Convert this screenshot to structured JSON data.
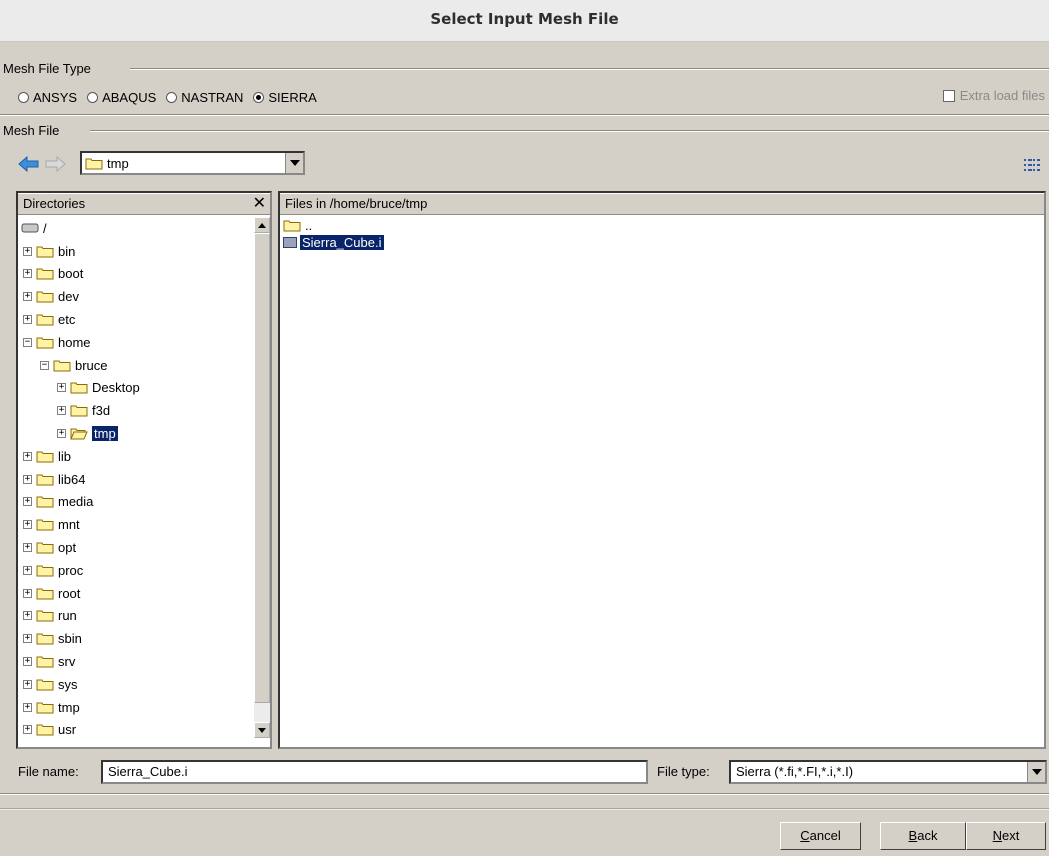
{
  "window": {
    "title": "Select Input Mesh File"
  },
  "mesh_file_type": {
    "label": "Mesh File Type",
    "options": [
      {
        "label": "ANSYS",
        "selected": false
      },
      {
        "label": "ABAQUS",
        "selected": false
      },
      {
        "label": "NASTRAN",
        "selected": false
      },
      {
        "label": "SIERRA",
        "selected": true
      }
    ],
    "extra_load_files": {
      "label": "Extra load files",
      "checked": false,
      "enabled": false
    }
  },
  "mesh_file": {
    "label": "Mesh File",
    "path_combo": {
      "value": "tmp"
    }
  },
  "directories": {
    "header": "Directories",
    "close_glyph": "✕",
    "tree": [
      {
        "label": "/",
        "depth": 0,
        "expander": "",
        "icon": "drive-icon"
      },
      {
        "label": "bin",
        "depth": 1,
        "expander": "+",
        "icon": "folder-icon"
      },
      {
        "label": "boot",
        "depth": 1,
        "expander": "+",
        "icon": "folder-icon"
      },
      {
        "label": "dev",
        "depth": 1,
        "expander": "+",
        "icon": "folder-icon"
      },
      {
        "label": "etc",
        "depth": 1,
        "expander": "+",
        "icon": "folder-icon"
      },
      {
        "label": "home",
        "depth": 1,
        "expander": "−",
        "icon": "folder-icon"
      },
      {
        "label": "bruce",
        "depth": 2,
        "expander": "−",
        "icon": "folder-icon"
      },
      {
        "label": "Desktop",
        "depth": 3,
        "expander": "+",
        "icon": "folder-icon"
      },
      {
        "label": "f3d",
        "depth": 3,
        "expander": "+",
        "icon": "folder-icon"
      },
      {
        "label": "tmp",
        "depth": 3,
        "expander": "+",
        "icon": "folder-open-icon",
        "selected": true
      },
      {
        "label": "lib",
        "depth": 1,
        "expander": "+",
        "icon": "folder-icon"
      },
      {
        "label": "lib64",
        "depth": 1,
        "expander": "+",
        "icon": "folder-icon"
      },
      {
        "label": "media",
        "depth": 1,
        "expander": "+",
        "icon": "folder-icon"
      },
      {
        "label": "mnt",
        "depth": 1,
        "expander": "+",
        "icon": "folder-icon"
      },
      {
        "label": "opt",
        "depth": 1,
        "expander": "+",
        "icon": "folder-icon"
      },
      {
        "label": "proc",
        "depth": 1,
        "expander": "+",
        "icon": "folder-icon"
      },
      {
        "label": "root",
        "depth": 1,
        "expander": "+",
        "icon": "folder-icon"
      },
      {
        "label": "run",
        "depth": 1,
        "expander": "+",
        "icon": "folder-icon"
      },
      {
        "label": "sbin",
        "depth": 1,
        "expander": "+",
        "icon": "folder-icon"
      },
      {
        "label": "srv",
        "depth": 1,
        "expander": "+",
        "icon": "folder-icon"
      },
      {
        "label": "sys",
        "depth": 1,
        "expander": "+",
        "icon": "folder-icon"
      },
      {
        "label": "tmp",
        "depth": 1,
        "expander": "+",
        "icon": "folder-icon"
      },
      {
        "label": "usr",
        "depth": 1,
        "expander": "+",
        "icon": "folder-icon"
      }
    ]
  },
  "files": {
    "header": "Files in /home/bruce/tmp",
    "items": [
      {
        "label": "..",
        "icon": "folder-icon",
        "selected": false
      },
      {
        "label": "Sierra_Cube.i",
        "icon": "file-icon",
        "selected": true
      }
    ]
  },
  "file_name": {
    "label": "File name:",
    "value": "Sierra_Cube.i"
  },
  "file_type": {
    "label": "File type:",
    "value": "Sierra (*.fi,*.FI,*.i,*.I)"
  },
  "buttons": {
    "cancel": {
      "mnemonic": "C",
      "rest": "ancel"
    },
    "back": {
      "mnemonic": "B",
      "rest": "ack"
    },
    "next": {
      "mnemonic": "N",
      "rest": "ext"
    }
  },
  "colors": {
    "dialog_bg": "#d4d0c8",
    "selection": "#0a246a",
    "folder_fill": "#fff3a8",
    "back_arrow": "#3b8fdc"
  }
}
